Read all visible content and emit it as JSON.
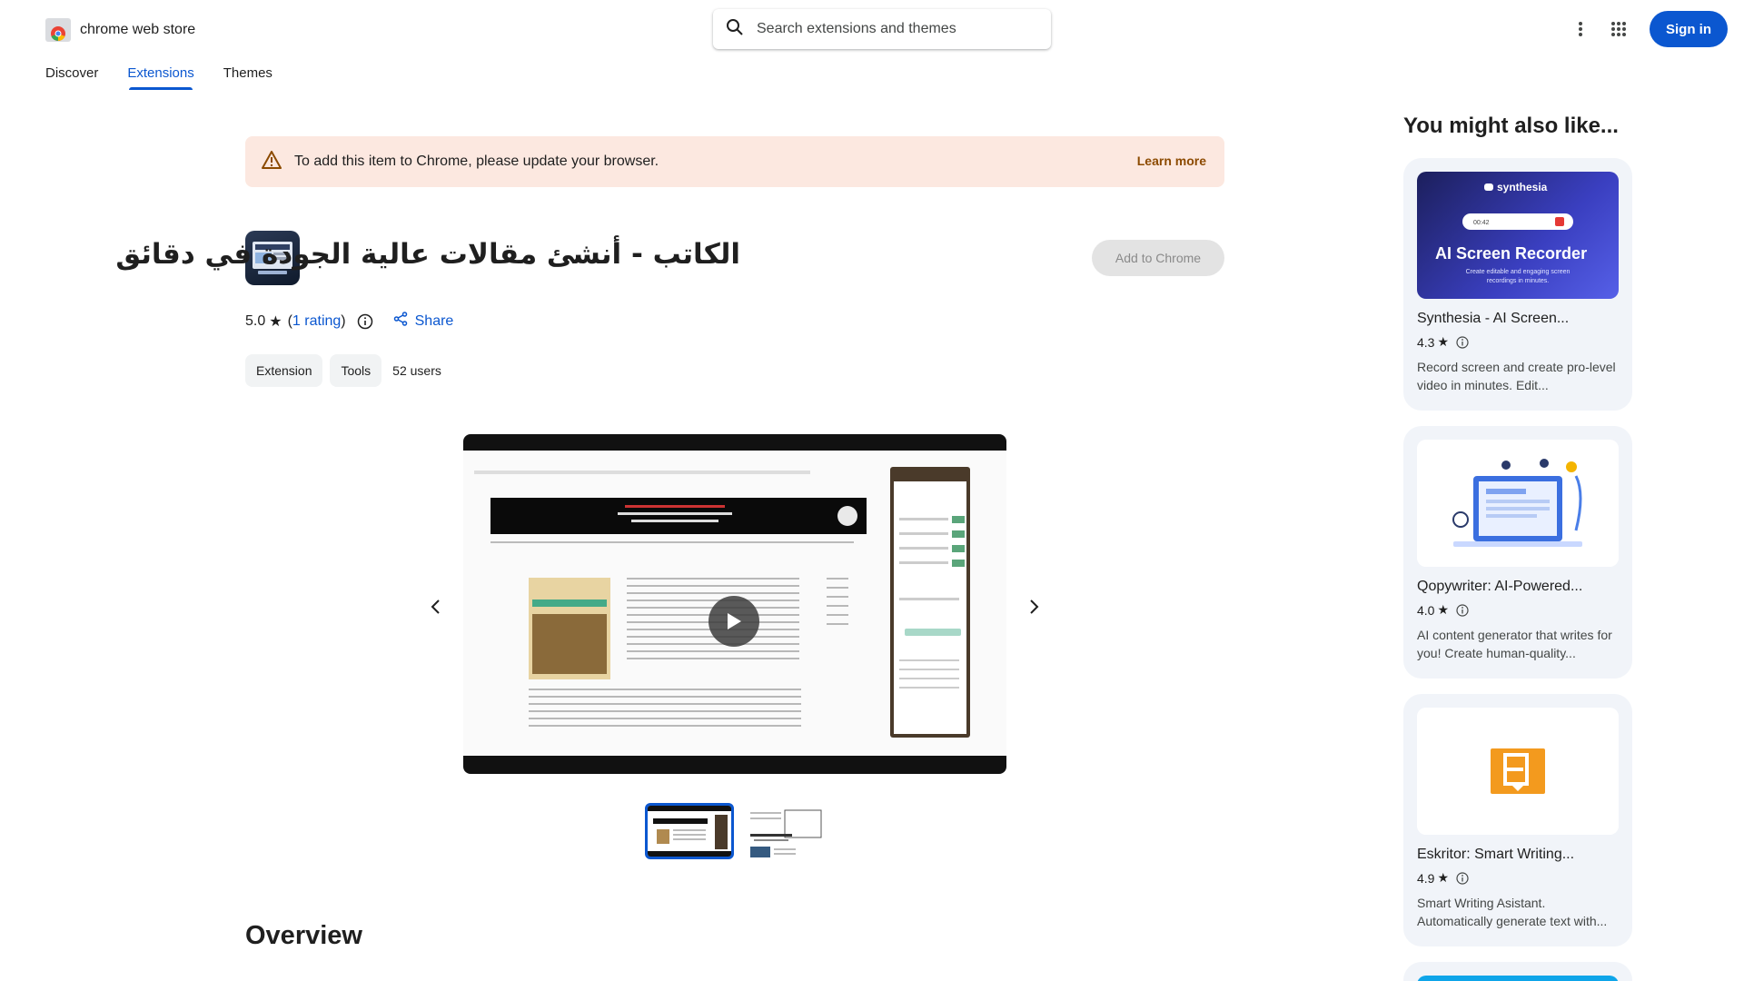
{
  "header": {
    "brand": "chrome web store",
    "search_placeholder": "Search extensions and themes",
    "signin_label": "Sign in",
    "nav_tabs": [
      {
        "label": "Discover"
      },
      {
        "label": "Extensions"
      },
      {
        "label": "Themes"
      }
    ],
    "active_tab": "Extensions"
  },
  "banner": {
    "text": "To add this item to Chrome, please update your browser.",
    "link": "Learn more"
  },
  "extension": {
    "title": "الكاتب - أنشئ مقالات عالية الجودة في دقائق",
    "add_button": "Add to Chrome",
    "rating_value": "5.0",
    "rating_star": "★",
    "rating_count_open": "(",
    "rating_count_link": "1 rating",
    "rating_count_close": ")",
    "share_label": "Share",
    "chips": [
      "Extension",
      "Tools"
    ],
    "users": "52 users"
  },
  "media": {
    "thumbnail_count": 2,
    "active_thumbnail": 1
  },
  "overview_heading": "Overview",
  "sidebar": {
    "title": "You might also like...",
    "cards": [
      {
        "name": "Synthesia - AI Screen...",
        "rating": "4.3",
        "desc": "Record screen and create pro-level video in minutes. Edit...",
        "img_brand": "synthesia",
        "img_time": "00:42",
        "img_headline": "AI Screen Recorder",
        "img_sub1": "Create editable and engaging screen",
        "img_sub2": "recordings in minutes."
      },
      {
        "name": "Qopywriter: AI-Powered...",
        "rating": "4.0",
        "desc": "AI content generator that writes for you! Create human-quality..."
      },
      {
        "name": "Eskritor: Smart Writing...",
        "rating": "4.9",
        "desc": "Smart Writing Asistant. Automatically generate text with..."
      }
    ]
  },
  "colors": {
    "accent": "#0b57d0",
    "banner_bg": "#fce8e0",
    "banner_link": "#8c4a00",
    "card_bg": "#f1f4f9",
    "eskritor_orange": "#f39a1e"
  }
}
